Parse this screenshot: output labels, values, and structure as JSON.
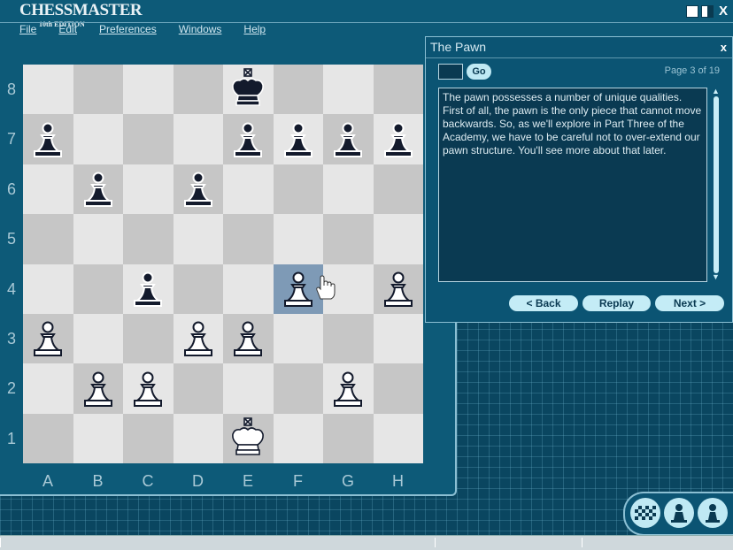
{
  "app": {
    "logo_main": "CHESSMASTER",
    "logo_sub": "10th EDITION"
  },
  "menu": [
    "File",
    "Edit",
    "Preferences",
    "Windows",
    "Help"
  ],
  "window_close": "X",
  "ranks": [
    "8",
    "7",
    "6",
    "5",
    "4",
    "3",
    "2",
    "1"
  ],
  "files": [
    "A",
    "B",
    "C",
    "D",
    "E",
    "F",
    "G",
    "H"
  ],
  "board": {
    "highlight": "f4",
    "pieces": [
      {
        "sq": "e8",
        "type": "king",
        "color": "black"
      },
      {
        "sq": "a7",
        "type": "pawn",
        "color": "black"
      },
      {
        "sq": "e7",
        "type": "pawn",
        "color": "black"
      },
      {
        "sq": "f7",
        "type": "pawn",
        "color": "black"
      },
      {
        "sq": "g7",
        "type": "pawn",
        "color": "black"
      },
      {
        "sq": "h7",
        "type": "pawn",
        "color": "black"
      },
      {
        "sq": "b6",
        "type": "pawn",
        "color": "black"
      },
      {
        "sq": "d6",
        "type": "pawn",
        "color": "black"
      },
      {
        "sq": "c4",
        "type": "pawn",
        "color": "black"
      },
      {
        "sq": "f4",
        "type": "pawn",
        "color": "white"
      },
      {
        "sq": "h4",
        "type": "pawn",
        "color": "white"
      },
      {
        "sq": "a3",
        "type": "pawn",
        "color": "white"
      },
      {
        "sq": "d3",
        "type": "pawn",
        "color": "white"
      },
      {
        "sq": "e3",
        "type": "pawn",
        "color": "white"
      },
      {
        "sq": "b2",
        "type": "pawn",
        "color": "white"
      },
      {
        "sq": "c2",
        "type": "pawn",
        "color": "white"
      },
      {
        "sq": "g2",
        "type": "pawn",
        "color": "white"
      },
      {
        "sq": "e1",
        "type": "king",
        "color": "white"
      }
    ]
  },
  "dialog": {
    "title": "The Pawn",
    "close": "x",
    "go_label": "Go",
    "page_info": "Page 3 of 19",
    "text": "The pawn possesses a number of unique qualities. First of all, the pawn is the only piece that cannot move backwards. So, as we'll explore in Part Three of the Academy, we have to be careful not to over-extend our pawn structure. You'll see more about that later.",
    "back_label": "< Back",
    "replay_label": "Replay",
    "next_label": "Next >"
  },
  "colors": {
    "accent": "#0d5a78",
    "button": "#c4ecf6",
    "highlight": "#7e9ab6"
  }
}
